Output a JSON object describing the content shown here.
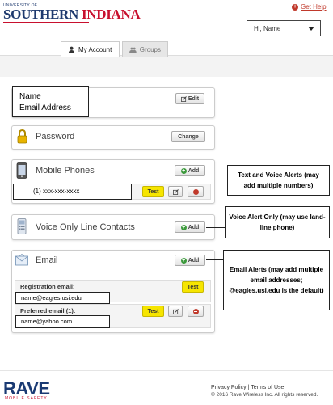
{
  "header": {
    "logo_small": "UNIVERSITY OF",
    "logo_southern": "SOUTHERN",
    "logo_indiana": "INDIANA",
    "get_help": "Get Help",
    "user_select_value": "Hi, Name"
  },
  "tabs": [
    {
      "label": "My Account",
      "icon": "person-icon",
      "active": true
    },
    {
      "label": "Groups",
      "icon": "group-icon",
      "active": false
    }
  ],
  "name_card": {
    "name_label": "Name",
    "email_label": "Email Address",
    "edit_label": "Edit"
  },
  "password_card": {
    "title": "Password",
    "change_label": "Change"
  },
  "phones_card": {
    "title": "Mobile Phones",
    "add_label": "Add",
    "entry": "(1)  xxx-xxx-xxxx",
    "test_label": "Test"
  },
  "voice_card": {
    "title": "Voice Only Line Contacts",
    "add_label": "Add"
  },
  "email_card": {
    "title": "Email",
    "add_label": "Add",
    "registration_label": "Registration email:",
    "registration_value": "name@eagles.usi.edu",
    "registration_test": "Test",
    "preferred_label": "Preferred email (1):",
    "preferred_value": "name@yahoo.com",
    "preferred_test": "Test"
  },
  "annotations": {
    "text_voice": "Text and Voice Alerts (may add multiple numbers)",
    "voice_only": "Voice Alert Only (may use land-line phone)",
    "email_alerts": "Email Alerts (may add multiple email addresses; @eagles.usi.edu is the default)"
  },
  "footer": {
    "rave": "RAVE",
    "rave_sub": "MOBILE SAFETY",
    "privacy": "Privacy Policy",
    "separator": "|",
    "terms": "Terms of Use",
    "copyright": "© 2016 Rave Wireless Inc. All rights reserved."
  },
  "colors": {
    "brand_blue": "#1f3a6e",
    "brand_red": "#c8102e",
    "test_yellow": "#f6e500",
    "add_green": "#3c9a3c"
  }
}
